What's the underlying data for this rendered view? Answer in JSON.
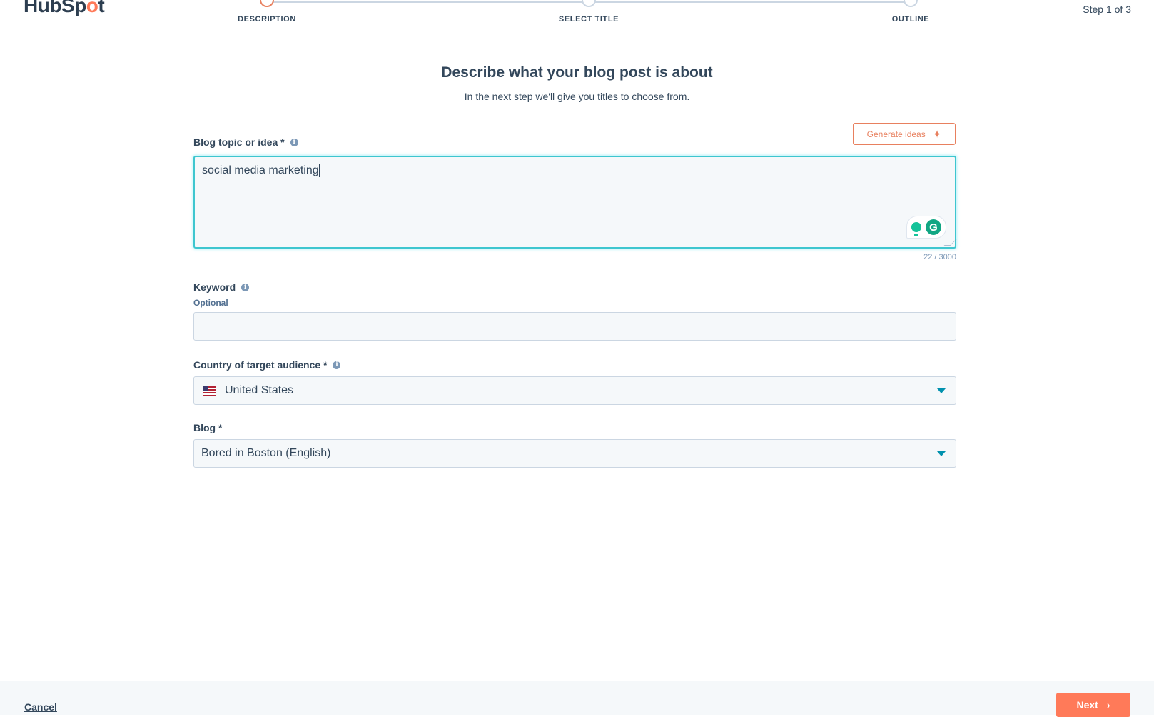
{
  "brand": {
    "logo_text_a": "HubSp",
    "logo_text_o": "o",
    "logo_text_b": "t"
  },
  "stepper": {
    "steps": [
      {
        "label": "DESCRIPTION",
        "active": true
      },
      {
        "label": "SELECT TITLE",
        "active": false
      },
      {
        "label": "OUTLINE",
        "active": false
      }
    ],
    "step_count": "Step 1 of 3"
  },
  "header": {
    "title": "Describe what your blog post is about",
    "subtitle": "In the next step we'll give you titles to choose from."
  },
  "form": {
    "generate_ideas_label": "Generate ideas",
    "topic": {
      "label": "Blog topic or idea *",
      "value": "social media marketing",
      "counter": "22 / 3000",
      "info_icon": "info-icon"
    },
    "keyword": {
      "label": "Keyword",
      "sublabel": "Optional",
      "value": ""
    },
    "country": {
      "label": "Country of target audience *",
      "value": "United States"
    },
    "blog": {
      "label": "Blog *",
      "value": "Bored in Boston (English)"
    }
  },
  "grammarly": {
    "g_letter": "G"
  },
  "footer": {
    "cancel_label": "Cancel",
    "next_label": "Next",
    "next_icon": "›"
  },
  "colors": {
    "accent": "#ff7a59",
    "focus": "#3ec6cf",
    "link": "#0091ae",
    "text": "#33475b"
  }
}
